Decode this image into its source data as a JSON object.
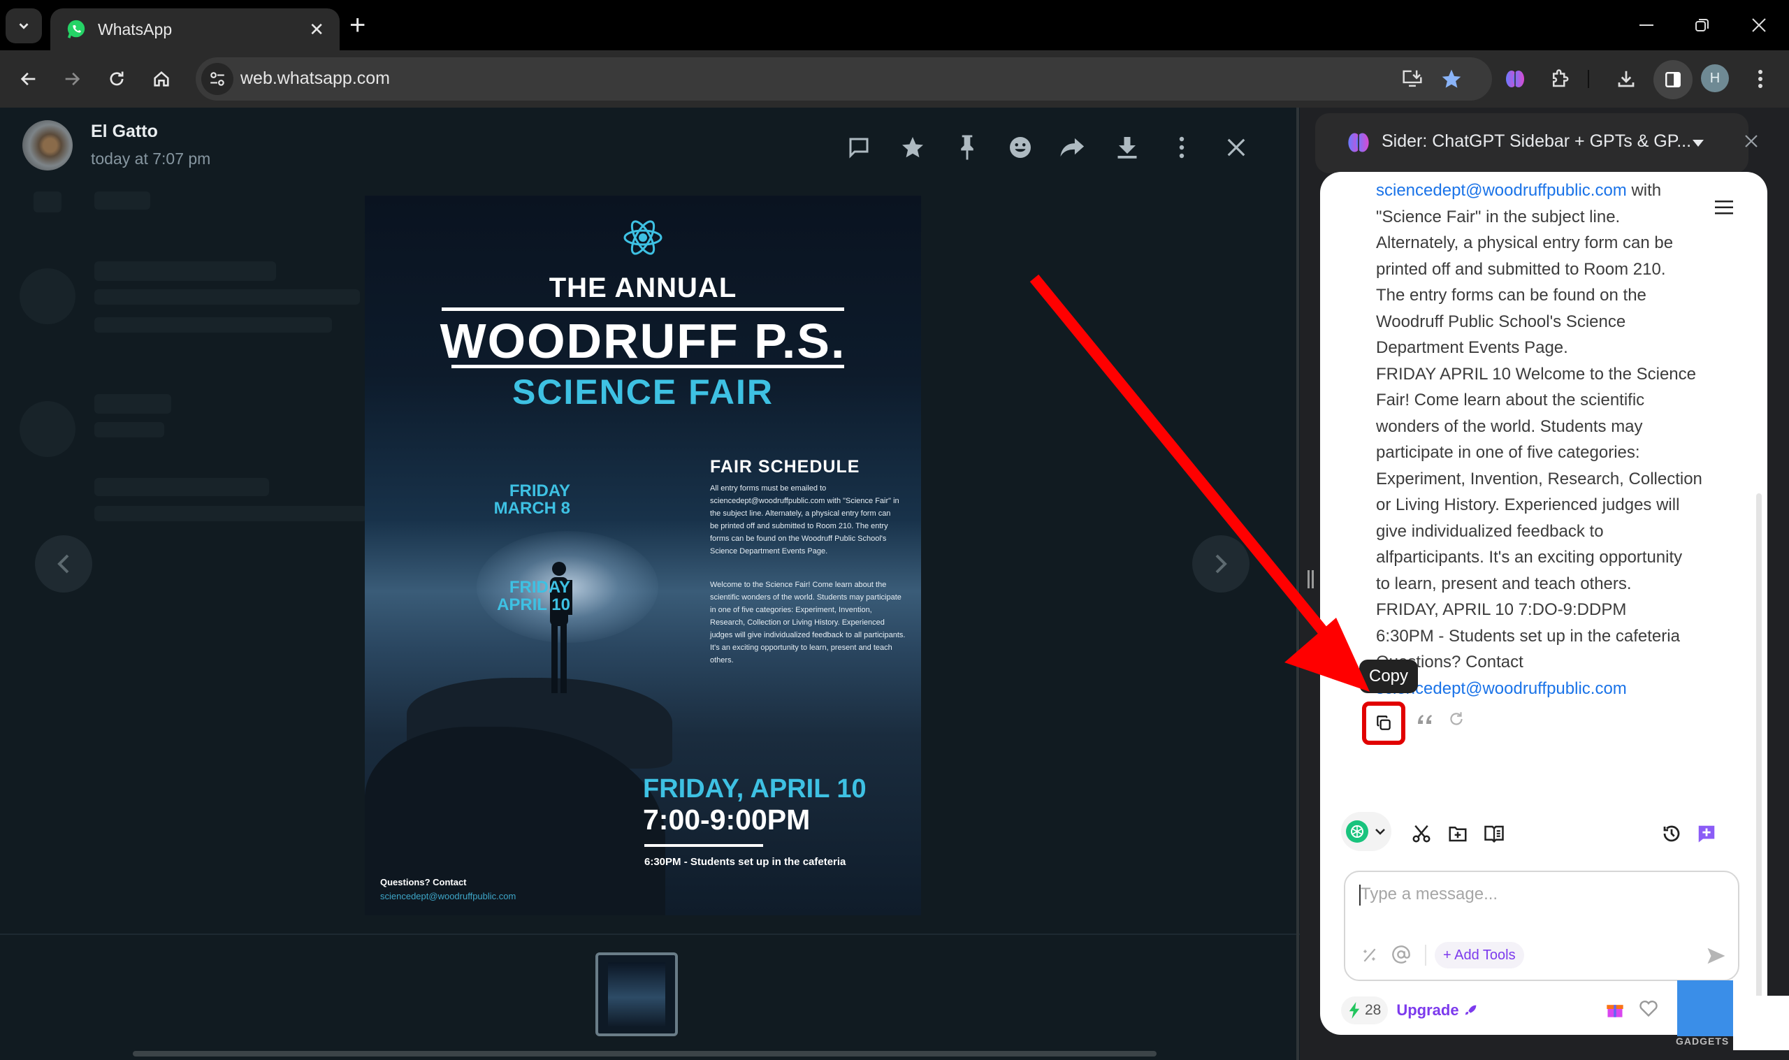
{
  "browser": {
    "tab_title": "WhatsApp",
    "url": "web.whatsapp.com",
    "profile_initial": "H",
    "new_tab_label": "+"
  },
  "viewer": {
    "sender": "El Gatto",
    "timestamp": "today at 7:07 pm",
    "actions": [
      "reply-icon",
      "star-icon",
      "pin-icon",
      "react-icon",
      "forward-icon",
      "download-icon",
      "more-icon",
      "close-icon"
    ]
  },
  "poster": {
    "annual": "THE ANNUAL",
    "school": "WOODRUFF P.S.",
    "event": "SCIENCE FAIR",
    "schedule_title": "FAIR SCHEDULE",
    "date1_line1": "FRIDAY",
    "date1_line2": "MARCH 8",
    "date1_text": "All entry forms must be emailed to sciencedept@woodruffpublic.com with \"Science Fair\" in the subject line. Alternately, a physical entry form can be printed off and submitted to Room 210. The entry forms can be found on the Woodruff Public School's Science Department Events Page.",
    "date2_line1": "FRIDAY",
    "date2_line2": "APRIL 10",
    "date2_text": "Welcome to the Science Fair! Come learn about the scientific wonders of the world. Students may participate in one of five categories: Experiment, Invention, Research, Collection or Living History. Experienced judges will give individualized feedback to all participants. It's an exciting opportunity to learn, present and teach others.",
    "big_date": "FRIDAY, APRIL 10",
    "big_time": "7:00-9:00PM",
    "setup": "6:30PM - Students set up in the cafeteria",
    "questions": "Questions? Contact",
    "contact_email": "sciencedept@woodruffpublic.com"
  },
  "sider": {
    "title": "Sider: ChatGPT Sidebar + GPTs & GP...",
    "message_lines": [
      {
        "link": "sciencedept@woodruffpublic.com",
        "text": " with"
      },
      {
        "text": "\"Science Fair\" in the subject line."
      },
      {
        "text": "Alternately, a physical entry form can be"
      },
      {
        "text": "printed off and submitted to Room 210."
      },
      {
        "text": "The entry forms can be found on the"
      },
      {
        "text": "Woodruff Public School's Science"
      },
      {
        "text": "Department Events Page."
      },
      {
        "text": "FRIDAY APRIL 10 Welcome to the Science"
      },
      {
        "text": "Fair! Come learn about the scientific"
      },
      {
        "text": "wonders of the world. Students may"
      },
      {
        "text": "participate in one of five categories:"
      },
      {
        "text": "Experiment, Invention, Research, Collection"
      },
      {
        "text": "or Living History. Experienced judges will"
      },
      {
        "text": "give individualized feedback to"
      },
      {
        "text": "alfparticipants. It's an exciting opportunity"
      },
      {
        "text": "to learn, present and teach others."
      },
      {
        "text": "FRIDAY, APRIL 10 7:DO-9:DDPM"
      },
      {
        "text": "6:30PM - Students set up in the cafeteria"
      },
      {
        "text": "Questions? Contact"
      },
      {
        "link": "sciencedept@woodruffpublic.com",
        "text": ""
      }
    ],
    "tooltip": "Copy",
    "input_placeholder": "Type a message...",
    "add_tools": "+ Add Tools",
    "credits": "28",
    "upgrade": "Upgrade"
  },
  "watermark": {
    "text": "GADGETS"
  },
  "colors": {
    "accent_purple": "#7c3aed",
    "link_blue": "#1a73e8",
    "highlight_red": "#e10000",
    "poster_cyan": "#3ec1e3"
  }
}
